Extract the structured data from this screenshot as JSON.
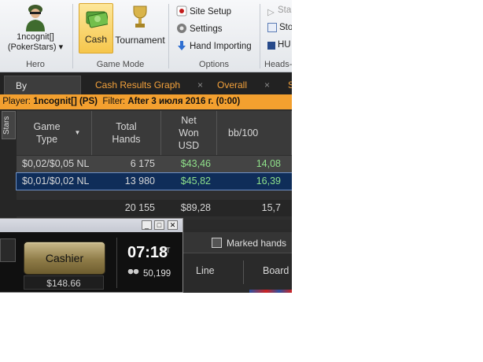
{
  "ribbon": {
    "hero": {
      "name_line1": "1ncognit[]",
      "name_line2": "(PokerStars)",
      "dropdown": "▾",
      "label": "Hero"
    },
    "game_mode": {
      "cash": "Cash",
      "tournament": "Tournament",
      "label": "Game Mode"
    },
    "options": {
      "site_setup": "Site Setup",
      "settings": "Settings",
      "hand_importing": "Hand Importing",
      "label": "Options"
    },
    "heads": {
      "item1": "Sta",
      "item2": "Sto",
      "item3": "HU",
      "label": "Heads-"
    }
  },
  "tabs": [
    {
      "label": "By Stakes",
      "close": "×"
    },
    {
      "label": "Cash Results Graph",
      "close": "×"
    },
    {
      "label": "Overall",
      "close": "×"
    },
    {
      "label": "S"
    }
  ],
  "filter": {
    "player_label": "Player:",
    "player_value": "1ncognit[] (PS)",
    "filter_label": "Filter:",
    "filter_value": "After 3 июля 2016 г. (0:00)"
  },
  "side_tab": "Stars",
  "table": {
    "headers": {
      "game_type": "Game Type",
      "sort_arrow": "▼",
      "total_hands": "Total Hands",
      "net_won": "Net Won USD",
      "bb100": "bb/100"
    },
    "rows": [
      {
        "game": "$0,02/$0,05 NL",
        "hands": "6 175",
        "won": "$43,46",
        "bb": "14,08"
      },
      {
        "game": "$0,01/$0,02 NL",
        "hands": "13 980",
        "won": "$45,82",
        "bb": "16,39"
      }
    ],
    "total": {
      "hands": "20 155",
      "won": "$89,28",
      "bb": "15,7"
    }
  },
  "hm_lower": {
    "marked_hands": "Marked hands",
    "col_line": "Line",
    "col_board": "Board"
  },
  "pokerstars": {
    "cashier": "Cashier",
    "balance": "$148.66",
    "time": "07:18",
    "tz": "ET",
    "players": "50,199",
    "win_min": "_",
    "win_max": "□",
    "win_close": "✕"
  },
  "colors": {
    "accent": "#f3a02f",
    "positive": "#8fe08a",
    "selected_row": "#0f2d59"
  }
}
